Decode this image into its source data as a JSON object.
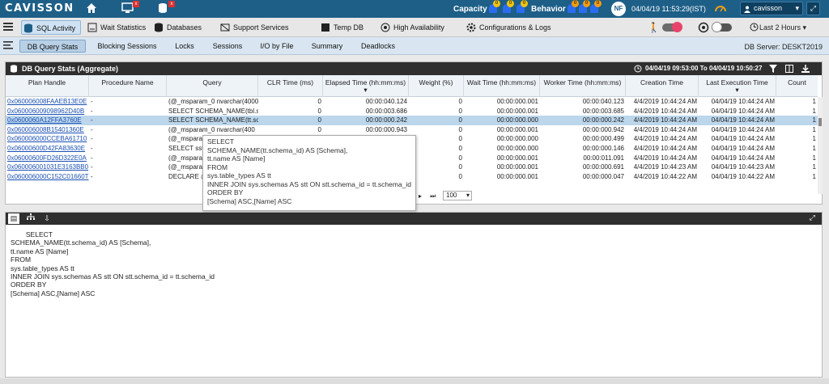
{
  "topbar": {
    "logo": "CAVISSON",
    "capacity_label": "Capacity",
    "behavior_label": "Behavior",
    "capacity_counts": [
      "0",
      "0",
      "0"
    ],
    "behavior_counts": [
      "0",
      "0",
      "0",
      "0"
    ],
    "avatar": "NF",
    "datetime": "04/04/19 11:53:29(IST)",
    "user": "cavisson"
  },
  "menu": {
    "items": [
      {
        "label": "SQL Activity",
        "icon": "sql-activity-icon"
      },
      {
        "label": "Wait Statistics",
        "icon": "wait-statistics-icon"
      },
      {
        "label": "Databases",
        "icon": "database-icon"
      },
      {
        "label": "Support Services",
        "icon": "support-services-icon"
      },
      {
        "label": "Temp DB",
        "icon": "temp-db-icon"
      },
      {
        "label": "High Availability",
        "icon": "high-availability-icon"
      },
      {
        "label": "Configurations & Logs",
        "icon": "gear-icon"
      }
    ],
    "time_range": "Last 2 Hours"
  },
  "subtabs": {
    "items": [
      "DB Query Stats",
      "Blocking Sessions",
      "Locks",
      "Sessions",
      "I/O by File",
      "Summary",
      "Deadlocks"
    ],
    "db_server": "DB Server: DESKT2019"
  },
  "panel": {
    "title": "DB Query Stats (Aggregate)",
    "range": "04/04/19 09:53:00 To 04/04/19 10:50:27"
  },
  "table": {
    "columns": [
      "Plan Handle",
      "Procedure Name",
      "Query",
      "CLR Time (ms)",
      "Elapsed Time (hh:mm:ms)",
      "Weight (%)",
      "Wait Time (hh:mm:ms)",
      "Worker Time (hh:mm:ms)",
      "Creation Time",
      "Last Execution Time",
      "Count"
    ],
    "rows": [
      [
        "0x060006008FAAEB13E0E",
        "-",
        "(@_msparam_0 nvarchar(4000",
        "0",
        "00:00:040.124",
        "0",
        "00:00:000.001",
        "00:00:040.123",
        "4/4/2019 10:44:24 AM",
        "04/04/19 10:44:24 AM",
        "1"
      ],
      [
        "0x060006009098962D40B",
        "-",
        "SELECT SCHEMA_NAME(tbl.s",
        "0",
        "00:00:003.686",
        "0",
        "00:00:000.001",
        "00:00:003.685",
        "4/4/2019 10:44:24 AM",
        "04/04/19 10:44:24 AM",
        "1"
      ],
      [
        "0x0600060A12FFA3760E",
        "-",
        "SELECT SCHEMA_NAME(tt.sc",
        "0",
        "00:00:000.242",
        "0",
        "00:00:000.000",
        "00:00:000.242",
        "4/4/2019 10:44:24 AM",
        "04/04/19 10:44:24 AM",
        "1"
      ],
      [
        "0x060006008B15401360E",
        "-",
        "(@_msparam_0 nvarchar(400",
        "0",
        "00:00:000.943",
        "0",
        "00:00:000.001",
        "00:00:000.942",
        "4/4/2019 10:44:24 AM",
        "04/04/19 10:44:24 AM",
        "1"
      ],
      [
        "0x060006000CCEBA61710",
        "-",
        "(@_msparam_0 nv",
        "",
        "",
        "0",
        "00:00:000.000",
        "00:00:000.499",
        "4/4/2019 10:44:24 AM",
        "04/04/19 10:44:24 AM",
        "1"
      ],
      [
        "0x06000600D42FA83630E",
        "-",
        "SELECT sst",
        "",
        "",
        "0",
        "00:00:000.000",
        "00:00:000.146",
        "4/4/2019 10:44:24 AM",
        "04/04/19 10:44:24 AM",
        "1"
      ],
      [
        "0x06000600FD26D322E0A",
        "-",
        "(@_msparam_0",
        "",
        "",
        "0",
        "00:00:000.001",
        "00:00:011.091",
        "4/4/2019 10:44:24 AM",
        "04/04/19 10:44:24 AM",
        "1"
      ],
      [
        "0x060006001031E3163BB0",
        "-",
        "(@_msparam_0",
        "",
        "",
        "0",
        "00:00:000.001",
        "00:00:000.691",
        "4/4/2019 10:44:23 AM",
        "04/04/19 10:44:23 AM",
        "1"
      ],
      [
        "0x060006000C152C01660T",
        "-",
        "DECLARE @",
        "",
        "",
        "0",
        "00:00:000.001",
        "00:00:000.047",
        "4/4/2019 10:44:22 AM",
        "04/04/19 10:44:22 AM",
        "1"
      ]
    ],
    "page_size": "100"
  },
  "tooltip": [
    "SELECT",
    "SCHEMA_NAME(tt.schema_id) AS [Schema],",
    "tt.name AS [Name]",
    "FROM",
    "sys.table_types AS tt",
    "INNER JOIN sys.schemas AS stt ON stt.schema_id = tt.schema_id",
    "ORDER BY",
    "[Schema] ASC,[Name] ASC"
  ],
  "sql_text": "        SELECT\nSCHEMA_NAME(tt.schema_id) AS [Schema],\ntt.name AS [Name]\nFROM\nsys.table_types AS tt\nINNER JOIN sys.schemas AS stt ON stt.schema_id = tt.schema_id\nORDER BY\n[Schema] ASC,[Name] ASC"
}
